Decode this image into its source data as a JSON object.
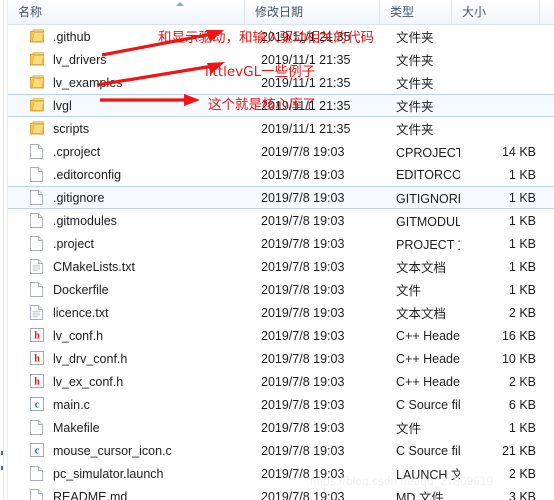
{
  "window": {
    "watermark": "https://blog.csdn.net/qq_27809619"
  },
  "columns": [
    {
      "key": "name",
      "label": "名称",
      "sorted": true,
      "sort_dir": "asc"
    },
    {
      "key": "date",
      "label": "修改日期",
      "sorted": false,
      "sort_dir": ""
    },
    {
      "key": "type",
      "label": "类型",
      "sorted": false,
      "sort_dir": ""
    },
    {
      "key": "size",
      "label": "大小",
      "sorted": false,
      "sort_dir": ""
    }
  ],
  "rows": [
    {
      "name": ".github",
      "date": "2019/11/1 21:35",
      "type": "文件夹",
      "size": "",
      "icon": "folder-icon",
      "selected": false
    },
    {
      "name": "lv_drivers",
      "date": "2019/11/1 21:35",
      "type": "文件夹",
      "size": "",
      "icon": "folder-icon",
      "selected": false
    },
    {
      "name": "lv_examples",
      "date": "2019/11/1 21:35",
      "type": "文件夹",
      "size": "",
      "icon": "folder-icon",
      "selected": false
    },
    {
      "name": "lvgl",
      "date": "2019/11/1 21:35",
      "type": "文件夹",
      "size": "",
      "icon": "folder-icon",
      "selected": true
    },
    {
      "name": "scripts",
      "date": "2019/11/1 21:35",
      "type": "文件夹",
      "size": "",
      "icon": "folder-icon",
      "selected": false
    },
    {
      "name": ".cproject",
      "date": "2019/7/8 19:03",
      "type": "CPROJECT 文件",
      "size": "14 KB",
      "icon": "blank-file-icon",
      "selected": false
    },
    {
      "name": ".editorconfig",
      "date": "2019/7/8 19:03",
      "type": "EDITORCONFIG ...",
      "size": "1 KB",
      "icon": "blank-file-icon",
      "selected": false
    },
    {
      "name": ".gitignore",
      "date": "2019/7/8 19:03",
      "type": "GITIGNORE 文件",
      "size": "1 KB",
      "icon": "blank-file-icon",
      "selected": true
    },
    {
      "name": ".gitmodules",
      "date": "2019/7/8 19:03",
      "type": "GITMODULES 文...",
      "size": "1 KB",
      "icon": "blank-file-icon",
      "selected": false
    },
    {
      "name": ".project",
      "date": "2019/7/8 19:03",
      "type": "PROJECT 文件",
      "size": "1 KB",
      "icon": "blank-file-icon",
      "selected": false
    },
    {
      "name": "CMakeLists.txt",
      "date": "2019/7/8 19:03",
      "type": "文本文档",
      "size": "1 KB",
      "icon": "text-file-icon",
      "selected": false
    },
    {
      "name": "Dockerfile",
      "date": "2019/7/8 19:03",
      "type": "文件",
      "size": "1 KB",
      "icon": "blank-file-icon",
      "selected": false
    },
    {
      "name": "licence.txt",
      "date": "2019/7/8 19:03",
      "type": "文本文档",
      "size": "2 KB",
      "icon": "text-file-icon",
      "selected": false
    },
    {
      "name": "lv_conf.h",
      "date": "2019/7/8 19:03",
      "type": "C++ Header file",
      "size": "16 KB",
      "icon": "h-header-icon",
      "selected": false
    },
    {
      "name": "lv_drv_conf.h",
      "date": "2019/7/8 19:03",
      "type": "C++ Header file",
      "size": "10 KB",
      "icon": "h-header-icon",
      "selected": false
    },
    {
      "name": "lv_ex_conf.h",
      "date": "2019/7/8 19:03",
      "type": "C++ Header file",
      "size": "2 KB",
      "icon": "h-header-icon",
      "selected": false
    },
    {
      "name": "main.c",
      "date": "2019/7/8 19:03",
      "type": "C Source file",
      "size": "6 KB",
      "icon": "c-source-icon",
      "selected": false
    },
    {
      "name": "Makefile",
      "date": "2019/7/8 19:03",
      "type": "文件",
      "size": "1 KB",
      "icon": "blank-file-icon",
      "selected": false
    },
    {
      "name": "mouse_cursor_icon.c",
      "date": "2019/7/8 19:03",
      "type": "C Source file",
      "size": "21 KB",
      "icon": "c-source-icon",
      "selected": false
    },
    {
      "name": "pc_simulator.launch",
      "date": "2019/7/8 19:03",
      "type": "LAUNCH 文件",
      "size": "2 KB",
      "icon": "blank-file-icon",
      "selected": false
    },
    {
      "name": "README.md",
      "date": "2019/7/8 19:03",
      "type": "MD 文件",
      "size": "3 KB",
      "icon": "blank-file-icon",
      "selected": false
    }
  ],
  "annotations": [
    {
      "id": "anno-drivers",
      "text": "和显示驱动，和输入驱动相关的代码",
      "color": "#f01414"
    },
    {
      "id": "anno-examples",
      "text": "littlevGL一些例子",
      "color": "#f01414"
    },
    {
      "id": "anno-core",
      "text": "这个就是核心库了",
      "color": "#f01414"
    }
  ],
  "colors": {
    "annotation_red": "#f01414",
    "selection_border": "#b9d4ea",
    "selection_fill": "#f6fafd",
    "header_text": "#45566b",
    "folder_yellow": "#fcd97a",
    "watermark": "#f0f0f0"
  }
}
